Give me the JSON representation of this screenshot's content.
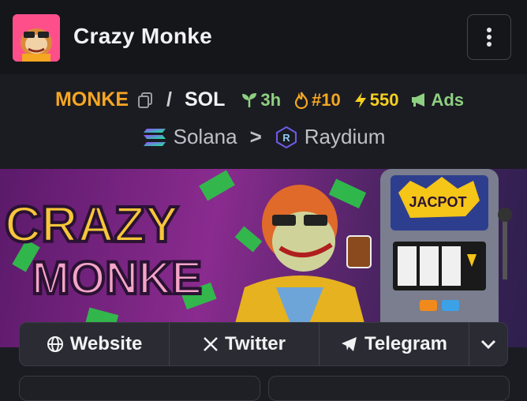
{
  "header": {
    "title": "Crazy Monke",
    "menu_icon": "vertical-dots-icon"
  },
  "pair": {
    "base": "MONKE",
    "separator": "/",
    "quote": "SOL",
    "age": "3h",
    "rank": "#10",
    "boosts": "550",
    "ads": "Ads"
  },
  "chain": {
    "name": "Solana",
    "arrow": ">",
    "dex": "Raydium"
  },
  "banner": {
    "line1": "CRAZY",
    "line2": "MONKE",
    "slot_sign": "JACPOT"
  },
  "links": {
    "website": "Website",
    "twitter": "Twitter",
    "telegram": "Telegram"
  },
  "colors": {
    "accent_orange": "#f5a623",
    "age_green": "#8ed081",
    "boost_yellow": "#f5d020"
  }
}
